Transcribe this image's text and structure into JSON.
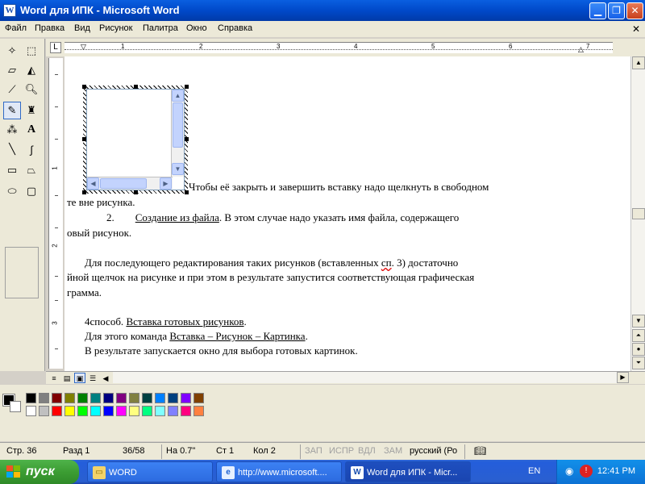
{
  "window": {
    "title": "Word для  ИПК - Microsoft Word",
    "app_icon": "W"
  },
  "menu": {
    "items": [
      "Файл",
      "Правка",
      "Вид",
      "Рисунок",
      "Палитра",
      "Окно",
      "Справка"
    ]
  },
  "toolbox": {
    "tools": [
      "select-star-icon",
      "select-rect-icon",
      "eraser-icon",
      "fill-bucket-icon",
      "color-picker-icon",
      "magnifier-icon",
      "pencil-icon",
      "brush-icon",
      "airbrush-icon",
      "text-icon",
      "line-icon",
      "curve-icon",
      "rectangle-icon",
      "polygon-icon",
      "ellipse-icon",
      "rounded-rect-icon"
    ],
    "selected": "pencil-icon",
    "text_tool_label": "A"
  },
  "ruler": {
    "numbers": [
      "1",
      "2",
      "3",
      "4",
      "5",
      "6",
      "7"
    ],
    "vertical_numbers": [
      "1",
      "2",
      "3"
    ]
  },
  "document": {
    "line1": "Чтобы её закрыть и завершить вставку надо щелкнуть в свободном",
    "line2": "те вне рисунка.",
    "line3_num": "2.",
    "line3_link": "Создание из файла",
    "line3_rest": ". В этом случае надо указать имя файла,  содержащего",
    "line4": "овый рисунок.",
    "line5_pre": "Для последующего редактирования таких рисунков (вставленных ",
    "line5_err": "сп",
    "line5_post": ". 3) достаточно",
    "line6": "йной щелчок на рисунке и при этом в результате запустится соответствующая графическая",
    "line7": "грамма.",
    "line8_pre": "4способ. ",
    "line8_link": "Вставка готовых рисунков",
    "line8_post": ".",
    "line9_pre": "Для этого команда ",
    "line9_link": "Вставка – Рисунок – Картинка",
    "line9_post": ".",
    "line10": "В результате запускается окно для выбора готовых картинок."
  },
  "palette": {
    "row1": [
      "#000000",
      "#808080",
      "#800000",
      "#808000",
      "#008000",
      "#008080",
      "#000080",
      "#800080",
      "#808040",
      "#004040",
      "#0080ff",
      "#004080",
      "#8000ff",
      "#804000"
    ],
    "row2": [
      "#ffffff",
      "#c0c0c0",
      "#ff0000",
      "#ffff00",
      "#00ff00",
      "#00ffff",
      "#0000ff",
      "#ff00ff",
      "#ffff80",
      "#00ff80",
      "#80ffff",
      "#8080ff",
      "#ff0080",
      "#ff8040"
    ]
  },
  "status": {
    "page": "Стр.  36",
    "section": "Разд  1",
    "pages": "36/58",
    "at": "На  0.7\"",
    "line": "Ст  1",
    "col": "Кол  2",
    "rec": "ЗАП",
    "trk": "ИСПР",
    "ext": "ВДЛ",
    "ovr": "ЗАМ",
    "language": "русский (Ро"
  },
  "taskbar": {
    "start": "пуск",
    "tasks": [
      {
        "label": "WORD",
        "icon": "folder-icon"
      },
      {
        "label": "http://www.microsoft....",
        "icon": "ie-icon"
      },
      {
        "label": "Word для  ИПК - Micr...",
        "icon": "word-icon"
      }
    ],
    "lang": "EN",
    "clock": "12:41 PM"
  }
}
